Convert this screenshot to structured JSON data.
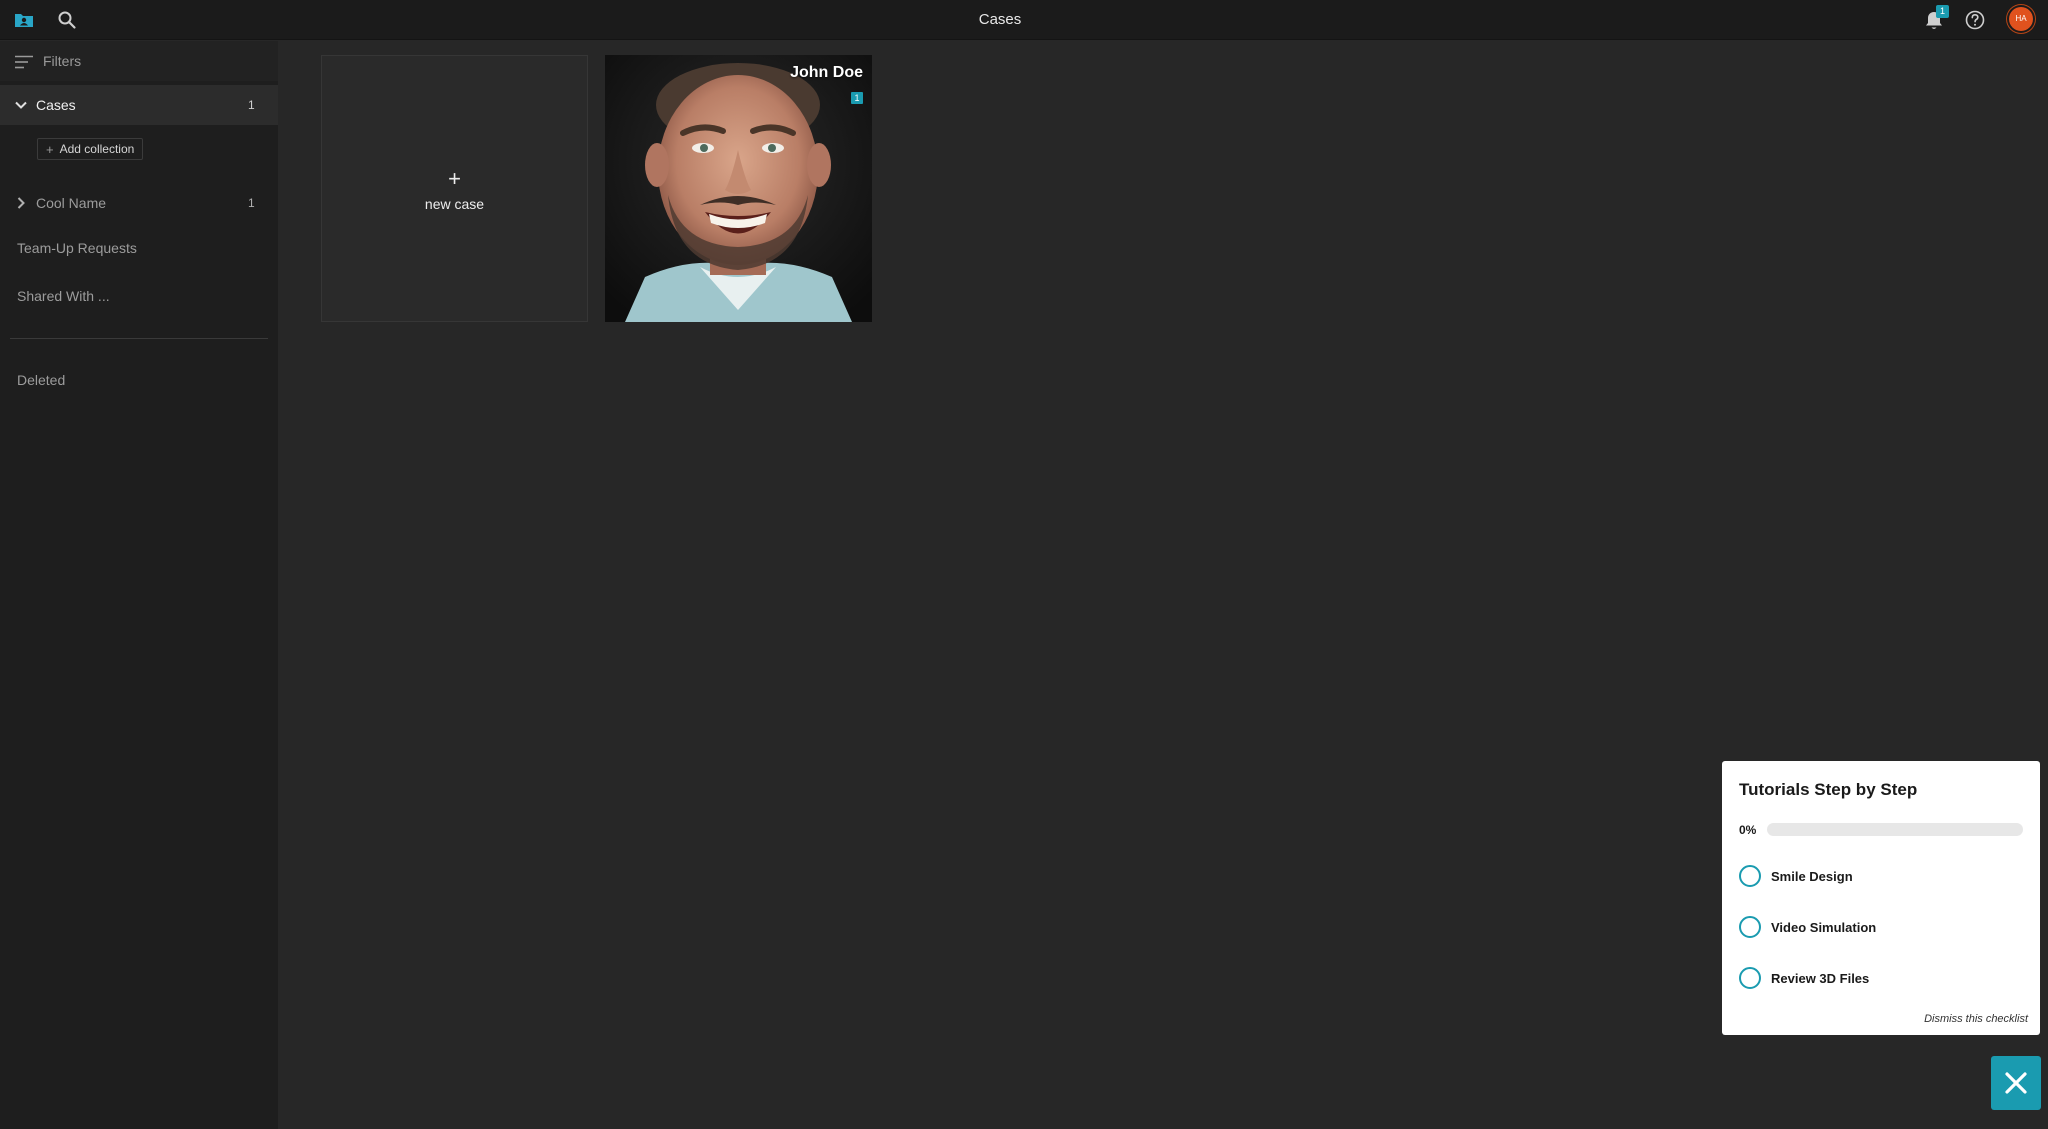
{
  "topbar": {
    "title": "Cases",
    "notification_count": "1",
    "avatar_initials": "HA"
  },
  "sidebar": {
    "filters_label": "Filters",
    "cases": {
      "label": "Cases",
      "count": "1"
    },
    "add_collection_label": "Add collection",
    "collections": [
      {
        "label": "Cool Name",
        "count": "1"
      }
    ],
    "team_up_label": "Team-Up Requests",
    "shared_label": "Shared With ...",
    "deleted_label": "Deleted"
  },
  "grid": {
    "new_case_plus": "+",
    "new_case_label": "new case",
    "cases": [
      {
        "name": "John Doe",
        "badge": "1"
      }
    ]
  },
  "tutorial": {
    "title": "Tutorials Step by Step",
    "progress_label": "0%",
    "progress": 0,
    "items": [
      {
        "label": "Smile Design"
      },
      {
        "label": "Video Simulation"
      },
      {
        "label": "Review 3D Files"
      }
    ],
    "dismiss_label": "Dismiss this checklist"
  },
  "colors": {
    "accent": "#1a9bb0",
    "avatar": "#e0521e",
    "background": "#272727",
    "sidebar": "#1e1e1e"
  },
  "icons": {
    "app": "folder-person-icon",
    "search": "search-icon",
    "notifications": "bell-icon",
    "help": "help-circle-icon",
    "close": "close-icon"
  }
}
